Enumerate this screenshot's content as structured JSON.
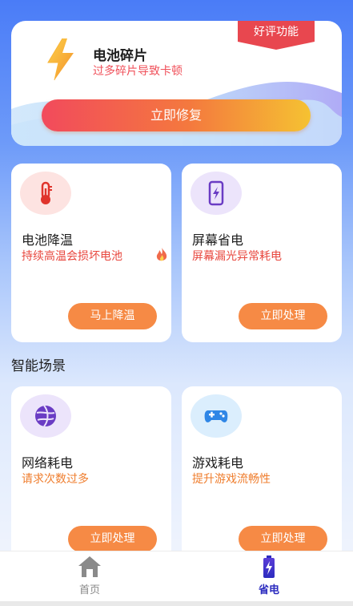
{
  "hero": {
    "title": "电池碎片",
    "subtitle": "过多碎片导致卡顿",
    "badge": "好评功能",
    "button": "立即修复",
    "icon": "lightning-bolt-icon"
  },
  "cards": [
    {
      "title": "电池降温",
      "subtitle": "持续高温会损坏电池",
      "button": "马上降温",
      "icon": "thermometer-icon",
      "subtitle_color": "#e8473e"
    },
    {
      "title": "屏幕省电",
      "subtitle": "屏幕漏光异常耗电",
      "button": "立即处理",
      "icon": "phone-charge-icon",
      "subtitle_color": "#e8473e"
    },
    {
      "title": "网络耗电",
      "subtitle": "请求次数过多",
      "button": "立即处理",
      "icon": "globe-icon",
      "subtitle_color": "#ef7d2d"
    },
    {
      "title": "游戏耗电",
      "subtitle": "提升游戏流畅性",
      "button": "立即处理",
      "icon": "gamepad-icon",
      "subtitle_color": "#ef7d2d"
    }
  ],
  "section": {
    "title": "智能场景"
  },
  "tabs": [
    {
      "label": "首页",
      "icon": "home-icon",
      "active": false,
      "color": "#888888"
    },
    {
      "label": "省电",
      "icon": "battery-icon",
      "active": true,
      "color": "#2b2bbf"
    }
  ],
  "colors": {
    "accent_orange": "#f68a45",
    "primary_blue": "#4a7cf7",
    "badge_red": "#e8474f"
  }
}
